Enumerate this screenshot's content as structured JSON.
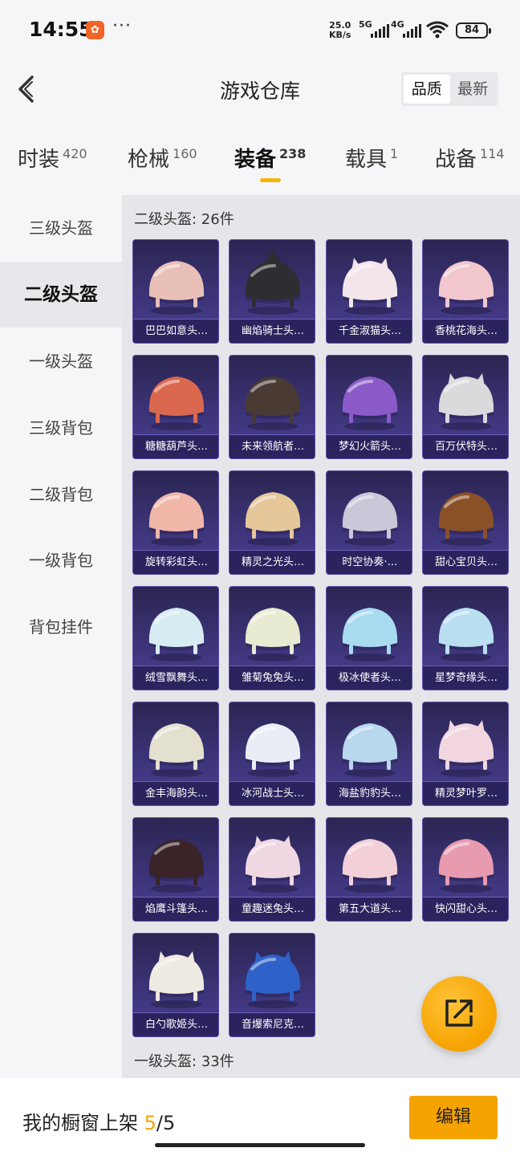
{
  "status": {
    "time": "14:55",
    "dots": "···",
    "speed_value": "25.0",
    "speed_unit": "KB/s",
    "net1": "5G",
    "net2": "4G",
    "battery": "84"
  },
  "header": {
    "title": "游戏仓库",
    "sort_options": [
      "品质",
      "最新"
    ]
  },
  "tabs": [
    {
      "label": "时装",
      "count": "420"
    },
    {
      "label": "枪械",
      "count": "160"
    },
    {
      "label": "装备",
      "count": "238"
    },
    {
      "label": "载具",
      "count": "1"
    },
    {
      "label": "战备",
      "count": "114"
    }
  ],
  "sidebar": {
    "items": [
      "三级头盔",
      "二级头盔",
      "一级头盔",
      "三级背包",
      "二级背包",
      "一级背包",
      "背包挂件"
    ]
  },
  "sections": {
    "current_title": "二级头盔: 26件",
    "next_title": "一级头盔: 33件"
  },
  "items": [
    {
      "name": "巴巴如意头…",
      "color": "#e8c0b8",
      "shape": "round"
    },
    {
      "name": "幽焰骑士头…",
      "color": "#2e2e32",
      "shape": "knight"
    },
    {
      "name": "千金淑猫头…",
      "color": "#f3e6ea",
      "shape": "cat"
    },
    {
      "name": "香桃花海头…",
      "color": "#f1c6cd",
      "shape": "round"
    },
    {
      "name": "糖糖葫芦头…",
      "color": "#d9684f",
      "shape": "round"
    },
    {
      "name": "未来领航者…",
      "color": "#4a3a34",
      "shape": "visor"
    },
    {
      "name": "梦幻火箭头…",
      "color": "#8a5bc8",
      "shape": "visor"
    },
    {
      "name": "百万伏特头…",
      "color": "#d8dadc",
      "shape": "cat"
    },
    {
      "name": "旋转彩虹头…",
      "color": "#f0b7a8",
      "shape": "round"
    },
    {
      "name": "精灵之光头…",
      "color": "#e6c79a",
      "shape": "round"
    },
    {
      "name": "时空协奏·…",
      "color": "#c9c7d8",
      "shape": "round"
    },
    {
      "name": "甜心宝贝头…",
      "color": "#8a5026",
      "shape": "round"
    },
    {
      "name": "绒雪飘舞头…",
      "color": "#d7ecf2",
      "shape": "round"
    },
    {
      "name": "雏菊兔兔头…",
      "color": "#e9ead2",
      "shape": "round"
    },
    {
      "name": "极冰使者头…",
      "color": "#a9dbf0",
      "shape": "visor"
    },
    {
      "name": "星梦奇缘头…",
      "color": "#b9dff0",
      "shape": "round"
    },
    {
      "name": "金丰海韵头…",
      "color": "#e4e0cf",
      "shape": "round"
    },
    {
      "name": "冰河战士头…",
      "color": "#e9eef6",
      "shape": "round"
    },
    {
      "name": "海盐豹豹头…",
      "color": "#b8d8ee",
      "shape": "visor"
    },
    {
      "name": "精灵梦叶罗…",
      "color": "#f1d6e0",
      "shape": "cat"
    },
    {
      "name": "焰鹰斗篷头…",
      "color": "#3a2428",
      "shape": "visor"
    },
    {
      "name": "童趣迷兔头…",
      "color": "#f0d8e2",
      "shape": "cat"
    },
    {
      "name": "第五大道头…",
      "color": "#f3d0d8",
      "shape": "round"
    },
    {
      "name": "快闪甜心头…",
      "color": "#e89aae",
      "shape": "visor"
    },
    {
      "name": "白勺歌姬头…",
      "color": "#eeeae2",
      "shape": "cat"
    },
    {
      "name": "音爆索尼克…",
      "color": "#2f62c8",
      "shape": "cat"
    }
  ],
  "bottom": {
    "label": "我的橱窗上架",
    "count": "5",
    "total": "/5",
    "edit": "编辑"
  },
  "colors": {
    "accent": "#f5a300",
    "card_bg": "#3c3478"
  },
  "icons": [
    "back-arrow-icon",
    "share-icon",
    "wifi-icon",
    "battery-icon"
  ]
}
